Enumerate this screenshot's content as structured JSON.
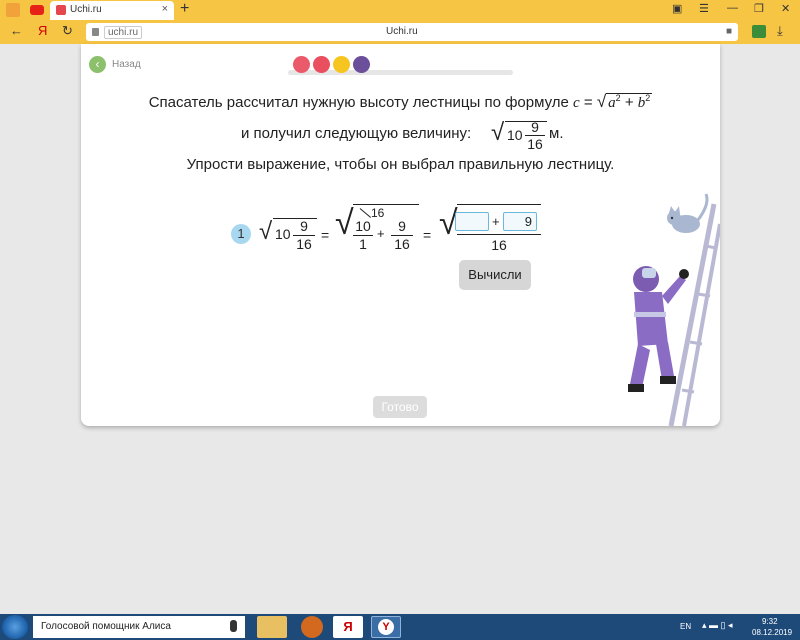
{
  "browser": {
    "tab_title": "Uchi.ru",
    "new_tab": "+",
    "tab_close": "×",
    "url": "uchi.ru",
    "page_title": "Uchi.ru",
    "nav_back": "←",
    "nav_yandex": "Я",
    "nav_reload": "↻",
    "win_menu": "☰",
    "win_minimize": "—",
    "win_restore": "❐",
    "win_close": "✕",
    "download": "⤓",
    "bookmark": "■"
  },
  "lesson": {
    "back_label": "Назад",
    "progress_colors": [
      "#ea5a6a",
      "#e94f5f",
      "#f6c520",
      "#6b4f9a"
    ],
    "prompt_line1": "Спасатель рассчитал нужную высоту лестницы по формуле",
    "formula_c": "c",
    "formula_eq": "=",
    "formula_a": "a",
    "formula_plus": "+",
    "formula_b": "b",
    "formula_exp": "2",
    "prompt_line2_before": "и получил следующую величину:",
    "value_whole": "10",
    "value_num": "9",
    "value_den": "16",
    "prompt_line2_after": "м.",
    "prompt_line3": "Упрости выражение, чтобы он выбрал правильную лестницу.",
    "step_number": "1",
    "eq_sign": "=",
    "term1_whole": "10",
    "term1_num": "9",
    "term1_den": "16",
    "term2_num": "10",
    "term2_den": "1",
    "term2_annot": "16",
    "term2_plus": "+",
    "term2_num2": "9",
    "term2_den2": "16",
    "term3_input1": "",
    "term3_plus": "+",
    "term3_input2": "9",
    "term3_den": "16",
    "calc_button": "Вычисли",
    "done_button": "Готово"
  },
  "taskbar": {
    "alice_label": "Голосовой помощник Алиса",
    "lang": "EN",
    "time": "9:32",
    "date": "08.12.2019"
  }
}
